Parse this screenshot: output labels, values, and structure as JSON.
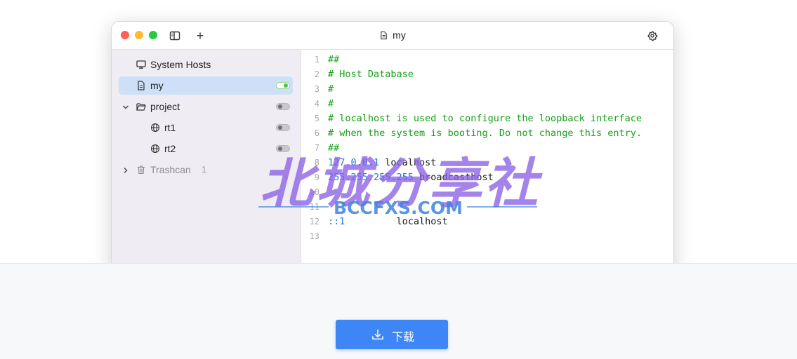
{
  "window": {
    "title": "my"
  },
  "sidebar": {
    "items": [
      {
        "label": "System Hosts",
        "icon": "monitor-icon"
      },
      {
        "label": "my",
        "icon": "document-icon",
        "selected": true,
        "enabled": true
      },
      {
        "label": "project",
        "icon": "folder-open-icon",
        "expanded": true,
        "enabled": false
      },
      {
        "label": "rt1",
        "icon": "globe-icon",
        "enabled": false
      },
      {
        "label": "rt2",
        "icon": "globe-icon",
        "enabled": false
      },
      {
        "label": "Trashcan",
        "icon": "trash-icon",
        "count": "1"
      }
    ]
  },
  "editor": {
    "lines": [
      {
        "n": "1",
        "comment": "##"
      },
      {
        "n": "2",
        "comment": "# Host Database"
      },
      {
        "n": "3",
        "comment": "#"
      },
      {
        "n": "4",
        "comment": "#"
      },
      {
        "n": "5",
        "comment": "# localhost is used to configure the loopback interface"
      },
      {
        "n": "6",
        "comment": "# when the system is booting. Do not change this entry."
      },
      {
        "n": "7",
        "comment": "##"
      },
      {
        "n": "8",
        "ip": "127.0.0.1",
        "host": " localhost"
      },
      {
        "n": "9",
        "ip": "255.255.255.255",
        "host": " broadcasthost"
      },
      {
        "n": "10"
      },
      {
        "n": "11"
      },
      {
        "n": "12",
        "ip": "::1",
        "host": "         localhost"
      },
      {
        "n": "13"
      }
    ]
  },
  "watermark": {
    "cn": "北城分享社",
    "en": "BCCFXS.COM"
  },
  "download": {
    "label": "下载"
  },
  "colors": {
    "accent": "#3e86f5",
    "selected": "#cde0f8",
    "comment": "#16a017",
    "ip": "#2478e0",
    "toggle_on": "#4cc04a"
  }
}
